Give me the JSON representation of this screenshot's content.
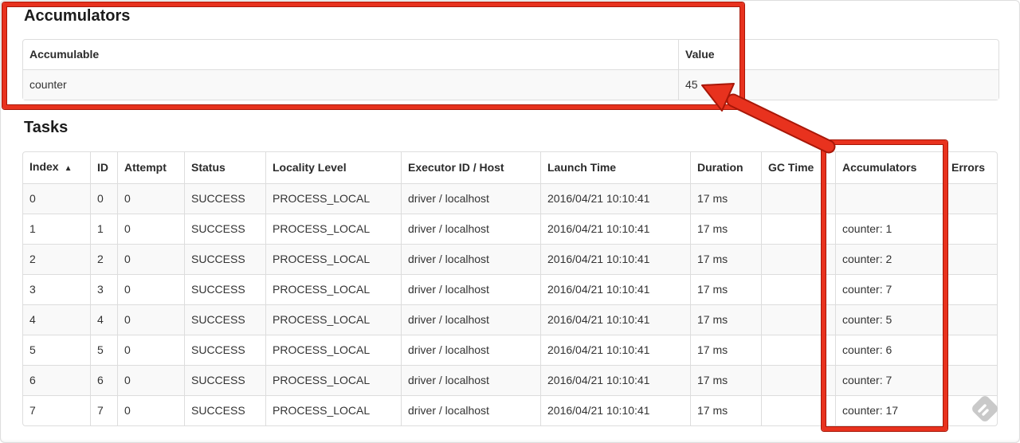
{
  "annotation_red": "#e8321e",
  "annotation_red_dark": "#a81708",
  "accumulators_section": {
    "title": "Accumulators",
    "table": {
      "headers": [
        "Accumulable",
        "Value"
      ],
      "rows": [
        [
          "counter",
          "45"
        ]
      ]
    }
  },
  "tasks_section": {
    "title": "Tasks",
    "sort_icon": "▲",
    "table": {
      "headers": [
        "Index",
        "ID",
        "Attempt",
        "Status",
        "Locality Level",
        "Executor ID / Host",
        "Launch Time",
        "Duration",
        "GC Time",
        "Accumulators",
        "Errors"
      ],
      "rows": [
        [
          "0",
          "0",
          "0",
          "SUCCESS",
          "PROCESS_LOCAL",
          "driver / localhost",
          "2016/04/21 10:10:41",
          "17 ms",
          "",
          "",
          ""
        ],
        [
          "1",
          "1",
          "0",
          "SUCCESS",
          "PROCESS_LOCAL",
          "driver / localhost",
          "2016/04/21 10:10:41",
          "17 ms",
          "",
          "counter: 1",
          ""
        ],
        [
          "2",
          "2",
          "0",
          "SUCCESS",
          "PROCESS_LOCAL",
          "driver / localhost",
          "2016/04/21 10:10:41",
          "17 ms",
          "",
          "counter: 2",
          ""
        ],
        [
          "3",
          "3",
          "0",
          "SUCCESS",
          "PROCESS_LOCAL",
          "driver / localhost",
          "2016/04/21 10:10:41",
          "17 ms",
          "",
          "counter: 7",
          ""
        ],
        [
          "4",
          "4",
          "0",
          "SUCCESS",
          "PROCESS_LOCAL",
          "driver / localhost",
          "2016/04/21 10:10:41",
          "17 ms",
          "",
          "counter: 5",
          ""
        ],
        [
          "5",
          "5",
          "0",
          "SUCCESS",
          "PROCESS_LOCAL",
          "driver / localhost",
          "2016/04/21 10:10:41",
          "17 ms",
          "",
          "counter: 6",
          ""
        ],
        [
          "6",
          "6",
          "0",
          "SUCCESS",
          "PROCESS_LOCAL",
          "driver / localhost",
          "2016/04/21 10:10:41",
          "17 ms",
          "",
          "counter: 7",
          ""
        ],
        [
          "7",
          "7",
          "0",
          "SUCCESS",
          "PROCESS_LOCAL",
          "driver / localhost",
          "2016/04/21 10:10:41",
          "17 ms",
          "",
          "counter: 17",
          ""
        ]
      ]
    }
  }
}
